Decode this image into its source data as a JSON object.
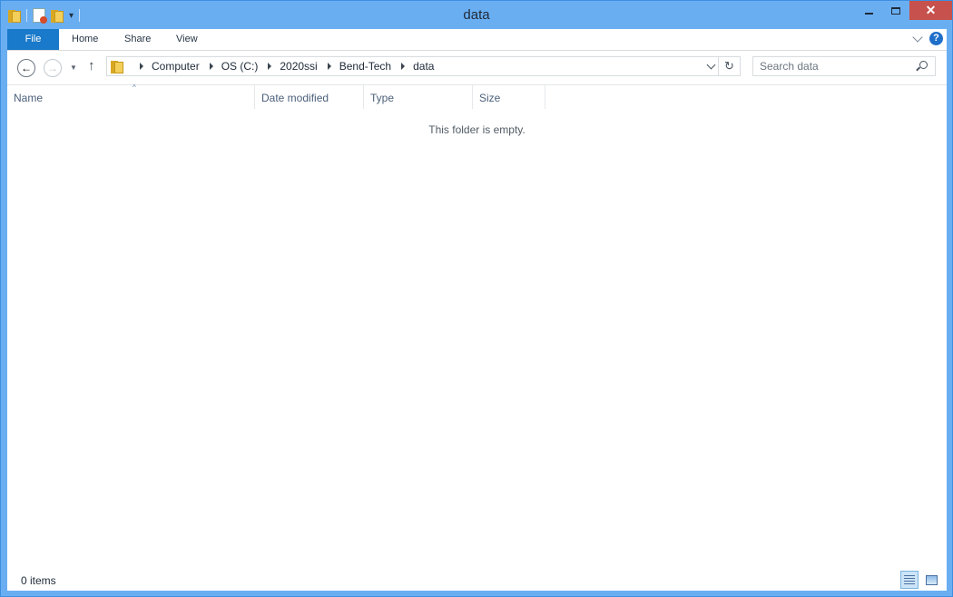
{
  "window": {
    "title": "data"
  },
  "quick_access": {
    "icons": [
      "folder-icon",
      "properties-icon",
      "new-folder-icon",
      "customize-dropdown-icon"
    ]
  },
  "ribbon": {
    "tabs": [
      {
        "label": "File"
      },
      {
        "label": "Home"
      },
      {
        "label": "Share"
      },
      {
        "label": "View"
      }
    ],
    "help_label": "?"
  },
  "address_bar": {
    "breadcrumbs": [
      "Computer",
      "OS (C:)",
      "2020ssi",
      "Bend-Tech",
      "data"
    ]
  },
  "search": {
    "placeholder": "Search data"
  },
  "columns": [
    {
      "label": "Name"
    },
    {
      "label": "Date modified"
    },
    {
      "label": "Type"
    },
    {
      "label": "Size"
    }
  ],
  "content": {
    "empty_message": "This folder is empty."
  },
  "status_bar": {
    "item_count": "0 items"
  },
  "colors": {
    "window_frame": "#6aaef2",
    "file_tab": "#1979ca",
    "close_button": "#c7514c"
  }
}
